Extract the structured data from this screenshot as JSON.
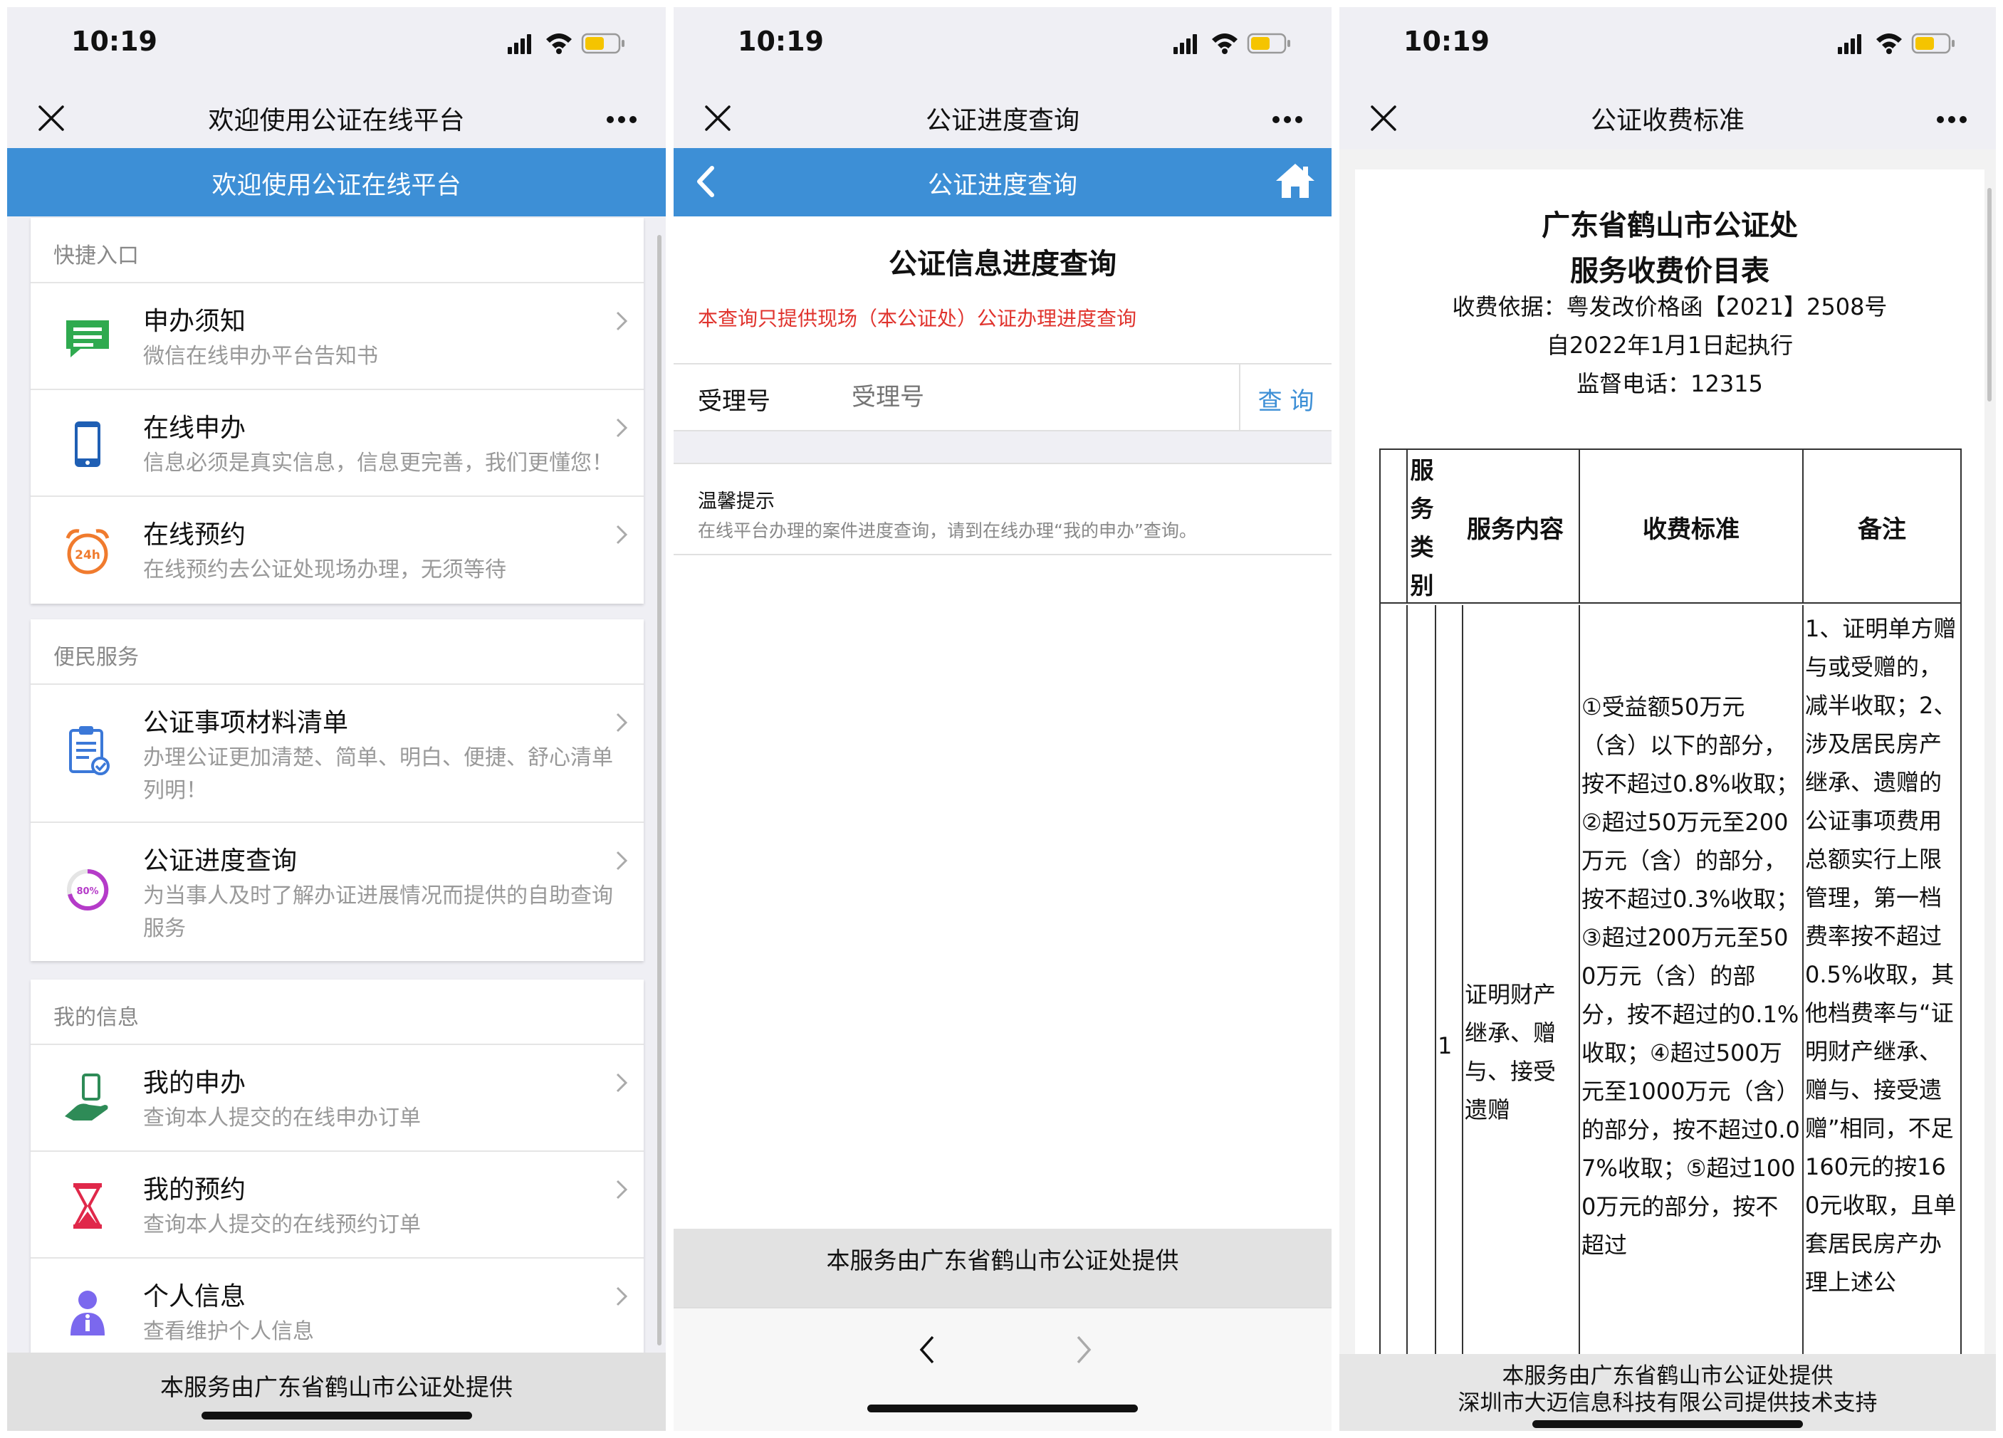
{
  "status": {
    "time": "10:19"
  },
  "panel1": {
    "nav_title": "欢迎使用公证在线平台",
    "banner_title": "欢迎使用公证在线平台",
    "sections": [
      {
        "header": "快捷入口",
        "items": [
          {
            "title": "申办须知",
            "subtitle": "微信在线申办平台告知书",
            "icon": "message-icon"
          },
          {
            "title": "在线申办",
            "subtitle": "信息必须是真实信息，信息更完善，我们更懂您！",
            "icon": "phone-icon"
          },
          {
            "title": "在线预约",
            "subtitle": "在线预约去公证处现场办理，无须等待",
            "icon": "alarm-clock-icon"
          }
        ]
      },
      {
        "header": "便民服务",
        "items": [
          {
            "title": "公证事项材料清单",
            "subtitle": "办理公证更加清楚、简单、明白、便捷、舒心清单列明！",
            "icon": "clipboard-icon"
          },
          {
            "title": "公证进度查询",
            "subtitle": "为当事人及时了解办证进展情况而提供的自助查询服务",
            "icon": "progress-icon"
          }
        ]
      },
      {
        "header": "我的信息",
        "items": [
          {
            "title": "我的申办",
            "subtitle": "查询本人提交的在线申办订单",
            "icon": "hand-phone-icon"
          },
          {
            "title": "我的预约",
            "subtitle": "查询本人提交的在线预约订单",
            "icon": "hourglass-icon"
          },
          {
            "title": "个人信息",
            "subtitle": "查看维护个人信息",
            "icon": "user-icon"
          }
        ]
      }
    ],
    "footer": "本服务由广东省鹤山市公证处提供",
    "progress_icon_text": "80%",
    "clock_icon_text": "24h"
  },
  "panel2": {
    "nav_title": "公证进度查询",
    "banner_title": "公证进度查询",
    "heading": "公证信息进度查询",
    "notice": "本查询只提供现场（本公证处）公证办理进度查询",
    "field_label": "受理号",
    "field_placeholder": "受理号",
    "query_button": "查 询",
    "tip_title": "温馨提示",
    "tip_text": "在线平台办理的案件进度查询，请到在线办理“我的申办”查询。",
    "footer": "本服务由广东省鹤山市公证处提供"
  },
  "panel3": {
    "nav_title": "公证收费标准",
    "doc_title_1": "广东省鹤山市公证处",
    "doc_title_2": "服务收费价目表",
    "basis": "收费依据：粤发改价格函【2021】2508号",
    "effective": "自2022年1月1日起执行",
    "hotline": "监督电话：12315",
    "table": {
      "headers": [
        "服务类别",
        "服务内容",
        "收费标准",
        "备注"
      ],
      "row_number": "1",
      "service_content": "证明财产继承、赠与、接受遗赠",
      "fee_standard": "①受益额50万元（含）以下的部分，按不超过0.8%收取；②超过50万元至200万元（含）的部分，按不超过0.3%收取；③超过200万元至500万元（含）的部分，按不超过的0.1%收取；④超过500万元至1000万元（含）的部分，按不超过0.07%收取；⑤超过1000万元的部分，按不超过",
      "remarks": "1、证明单方赠与或受赠的，减半收取；2、涉及居民房产继承、遗赠的公证事项费用总额实行上限管理，第一档费率按不超过0.5%收取，其他档费率与“证明财产继承、赠与、接受遗赠”相同，不足160元的按160元收取，且单套居民房产办理上述公"
    },
    "footer_line1": "本服务由广东省鹤山市公证处提供",
    "footer_line2": "深圳市大迈信息科技有限公司提供技术支持"
  },
  "colors": {
    "accent": "#3d8fd6",
    "notice": "#e0332d",
    "link": "#3d8fd6"
  }
}
